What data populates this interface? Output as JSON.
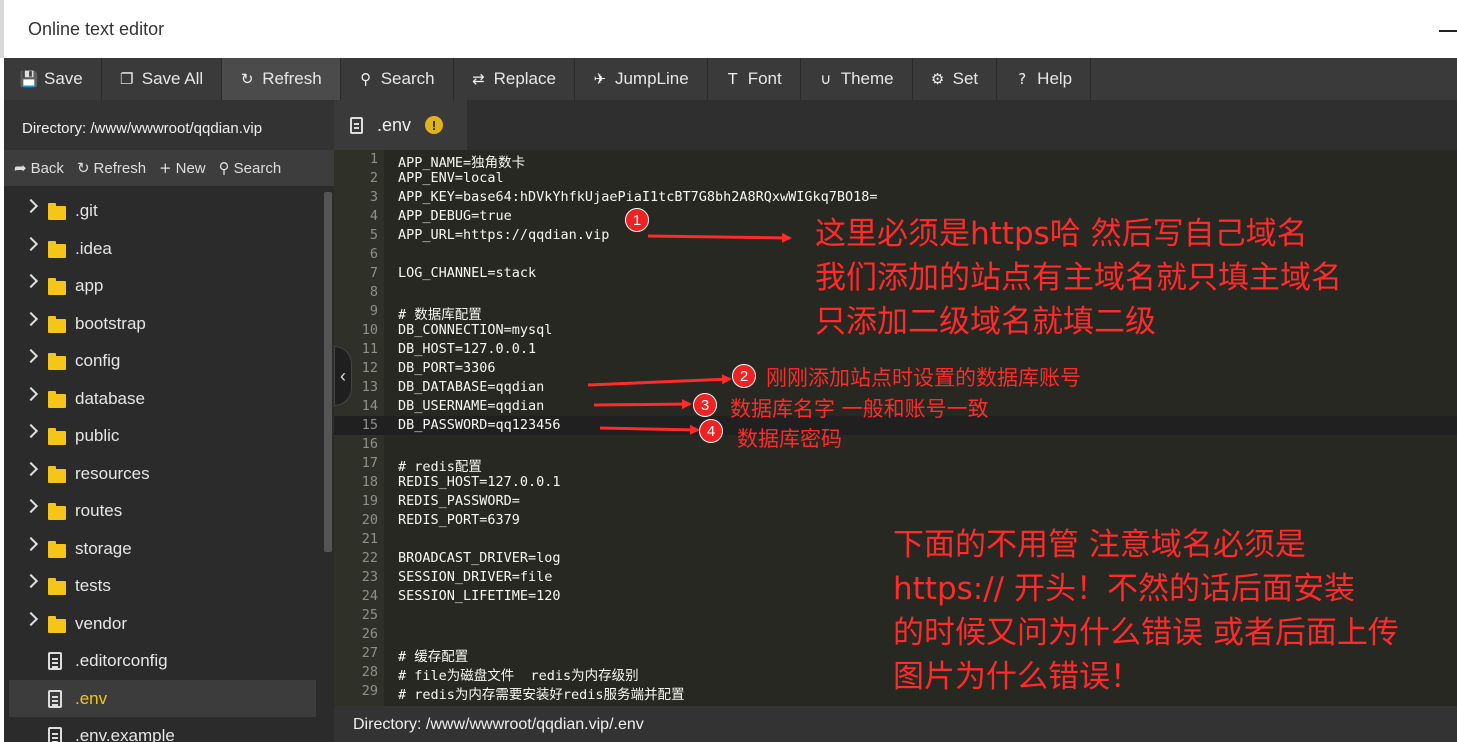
{
  "window": {
    "title": "Online text editor"
  },
  "toolbar": [
    {
      "label": "Save",
      "icon": "save-icon",
      "glyph": "💾"
    },
    {
      "label": "Save All",
      "icon": "save-all-icon",
      "glyph": "❐"
    },
    {
      "label": "Refresh",
      "icon": "refresh-icon",
      "glyph": "↻"
    },
    {
      "label": "Search",
      "icon": "search-icon",
      "glyph": "⚲"
    },
    {
      "label": "Replace",
      "icon": "replace-icon",
      "glyph": "⇄"
    },
    {
      "label": "JumpLine",
      "icon": "pin-icon",
      "glyph": "✈"
    },
    {
      "label": "Font",
      "icon": "font-icon",
      "glyph": "T"
    },
    {
      "label": "Theme",
      "icon": "magnet-icon",
      "glyph": "∪"
    },
    {
      "label": "Set",
      "icon": "gear-icon",
      "glyph": "⚙"
    },
    {
      "label": "Help",
      "icon": "help-icon",
      "glyph": "?"
    }
  ],
  "left_panel": {
    "directory": "Directory: /www/wwwroot/qqdian.vip",
    "actions": [
      {
        "label": "Back",
        "icon": "back-icon",
        "glyph": "➦"
      },
      {
        "label": "Refresh",
        "icon": "refresh-icon",
        "glyph": "↻"
      },
      {
        "label": "New",
        "icon": "plus-icon",
        "glyph": "+"
      },
      {
        "label": "Search",
        "icon": "search-icon",
        "glyph": "⚲"
      }
    ],
    "tree": [
      {
        "label": ".git",
        "type": "folder"
      },
      {
        "label": ".idea",
        "type": "folder"
      },
      {
        "label": "app",
        "type": "folder"
      },
      {
        "label": "bootstrap",
        "type": "folder"
      },
      {
        "label": "config",
        "type": "folder"
      },
      {
        "label": "database",
        "type": "folder"
      },
      {
        "label": "public",
        "type": "folder"
      },
      {
        "label": "resources",
        "type": "folder"
      },
      {
        "label": "routes",
        "type": "folder"
      },
      {
        "label": "storage",
        "type": "folder"
      },
      {
        "label": "tests",
        "type": "folder"
      },
      {
        "label": "vendor",
        "type": "folder"
      },
      {
        "label": ".editorconfig",
        "type": "file"
      },
      {
        "label": ".env",
        "type": "file",
        "selected": true
      },
      {
        "label": ".env.example",
        "type": "file"
      }
    ]
  },
  "editor": {
    "tab": {
      "label": ".env",
      "warning": "!"
    },
    "active_line": 15,
    "lines": [
      "APP_NAME=独角数卡",
      "APP_ENV=local",
      "APP_KEY=base64:hDVkYhfkUjaePiaI1tcBT7G8bh2A8RQxwWIGkq7BO18=",
      "APP_DEBUG=true",
      "APP_URL=https://qqdian.vip",
      "",
      "LOG_CHANNEL=stack",
      "",
      "# 数据库配置",
      "DB_CONNECTION=mysql",
      "DB_HOST=127.0.0.1",
      "DB_PORT=3306",
      "DB_DATABASE=qqdian",
      "DB_USERNAME=qqdian",
      "DB_PASSWORD=qq123456",
      "",
      "# redis配置",
      "REDIS_HOST=127.0.0.1",
      "REDIS_PASSWORD=",
      "REDIS_PORT=6379",
      "",
      "BROADCAST_DRIVER=log",
      "SESSION_DRIVER=file",
      "SESSION_LIFETIME=120",
      "",
      "",
      "# 缓存配置",
      "# file为磁盘文件  redis为内存级别",
      "# redis为内存需要安装好redis服务端并配置"
    ],
    "status": "Directory: /www/wwwroot/qqdian.vip/.env"
  },
  "annotations": {
    "badges": [
      "1",
      "2",
      "3",
      "4"
    ],
    "note1": [
      "这里必须是https哈  然后写自己域名",
      "我们添加的站点有主域名就只填主域名",
      "只添加二级域名就填二级"
    ],
    "note2": "刚刚添加站点时设置的数据库账号",
    "note3": "数据库名字  一般和账号一致",
    "note4": "数据库密码",
    "note5": [
      "下面的不用管  注意域名必须是",
      "https://   开头！不然的话后面安装",
      "的时候又问为什么错误 或者后面上传",
      "图片为什么错误！"
    ],
    "color": "#ff2a2a"
  }
}
